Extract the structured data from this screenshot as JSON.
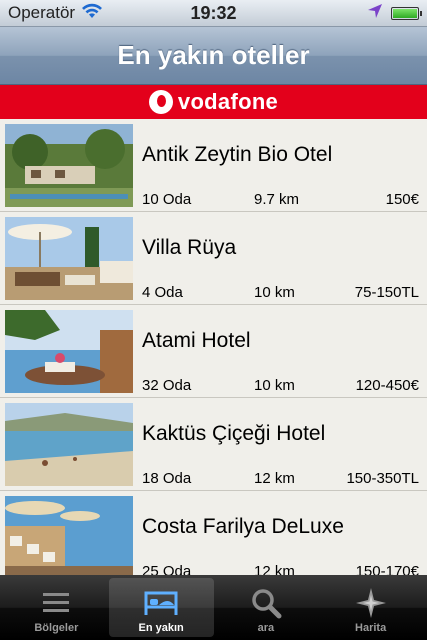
{
  "status_bar": {
    "carrier": "Operatör",
    "time": "19:32"
  },
  "nav": {
    "title": "En yakın oteller"
  },
  "banner": {
    "brand": "vodafone",
    "brand_color": "#e3001b"
  },
  "hotels": [
    {
      "name": "Antik Zeytin Bio Otel",
      "rooms": "10 Oda",
      "distance": "9.7 km",
      "price": "150€"
    },
    {
      "name": "Villa Rüya",
      "rooms": "4 Oda",
      "distance": "10 km",
      "price": "75-150TL"
    },
    {
      "name": "Atami Hotel",
      "rooms": "32 Oda",
      "distance": "10 km",
      "price": "120-450€"
    },
    {
      "name": "Kaktüs Çiçeği Hotel",
      "rooms": "18 Oda",
      "distance": "12 km",
      "price": "150-350TL"
    },
    {
      "name": "Costa Farilya DeLuxe",
      "rooms": "25 Oda",
      "distance": "12 km",
      "price": "150-170€"
    }
  ],
  "tabs": [
    {
      "label": "Bölgeler",
      "icon": "list-icon",
      "selected": false
    },
    {
      "label": "En yakın",
      "icon": "bed-icon",
      "selected": true
    },
    {
      "label": "ara",
      "icon": "search-icon",
      "selected": false
    },
    {
      "label": "Harita",
      "icon": "compass-icon",
      "selected": false
    }
  ]
}
